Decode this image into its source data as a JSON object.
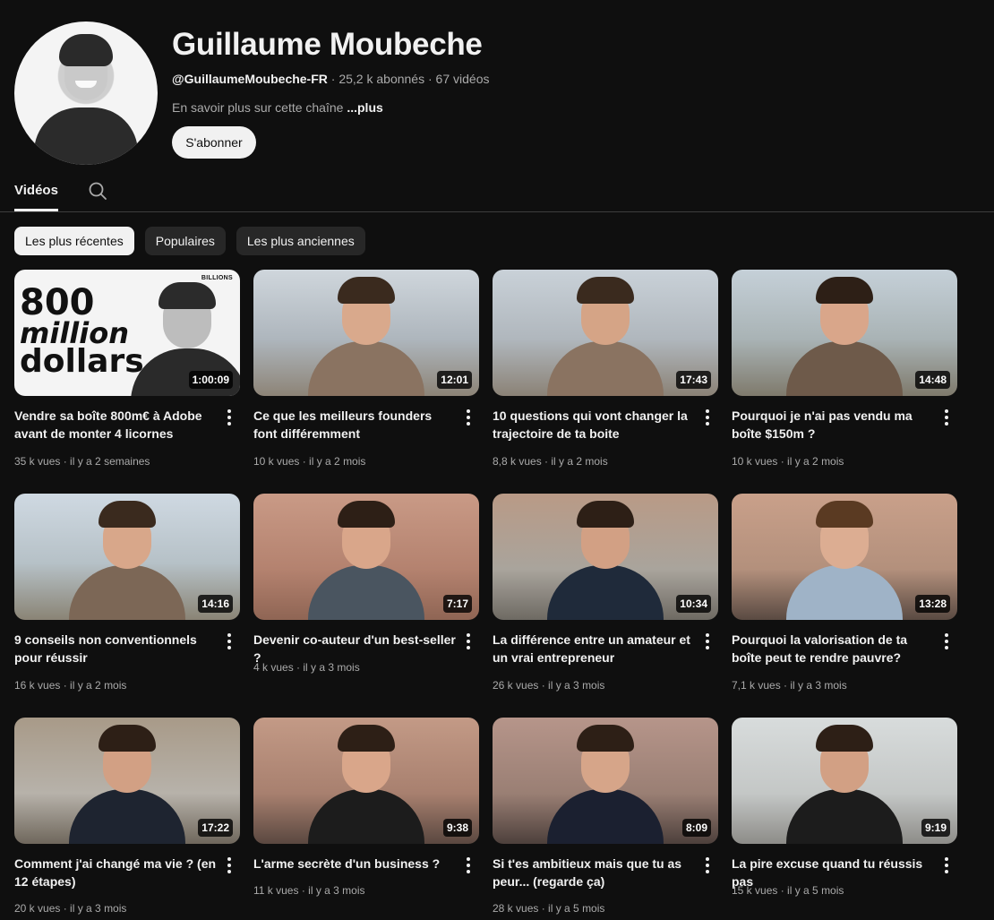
{
  "channel": {
    "name": "Guillaume Moubeche",
    "handle": "@GuillaumeMoubeche-FR",
    "subscribers": "25,2 k abonnés",
    "video_count": "67 vidéos",
    "separator": " · ",
    "about": "En savoir plus sur cette chaîne",
    "about_more": "...plus",
    "subscribe_label": "S'abonner"
  },
  "tabs": {
    "videos_label": "Vidéos"
  },
  "chips": [
    {
      "label": "Les plus récentes",
      "active": true
    },
    {
      "label": "Populaires",
      "active": false
    },
    {
      "label": "Les plus anciennes",
      "active": false
    }
  ],
  "thumb0_text": {
    "line1": "800",
    "line2": "million",
    "line3": "dollars",
    "brand": "BILLIONS"
  },
  "videos": [
    {
      "title": "Vendre sa boîte 800m€ à Adobe avant de monter 4 licornes",
      "views": "35 k vues",
      "age": "il y a 2 semaines",
      "duration": "1:00:09"
    },
    {
      "title": "Ce que les meilleurs founders font différemment",
      "views": "10 k vues",
      "age": "il y a 2 mois",
      "duration": "12:01"
    },
    {
      "title": "10 questions qui vont changer la trajectoire de ta boite",
      "views": "8,8 k vues",
      "age": "il y a 2 mois",
      "duration": "17:43"
    },
    {
      "title": "Pourquoi je n'ai pas vendu ma boîte $150m ?",
      "views": "10 k vues",
      "age": "il y a 2 mois",
      "duration": "14:48"
    },
    {
      "title": "9 conseils non conventionnels pour réussir",
      "views": "16 k vues",
      "age": "il y a 2 mois",
      "duration": "14:16"
    },
    {
      "title": "Devenir co-auteur d'un best-seller ?",
      "views": "4 k vues",
      "age": "il y a 3 mois",
      "duration": "7:17"
    },
    {
      "title": "La différence entre un amateur et un vrai entrepreneur",
      "views": "26 k vues",
      "age": "il y a 3 mois",
      "duration": "10:34"
    },
    {
      "title": "Pourquoi la valorisation de ta boîte peut te rendre pauvre?",
      "views": "7,1 k vues",
      "age": "il y a 3 mois",
      "duration": "13:28"
    },
    {
      "title": "Comment j'ai changé ma vie ? (en 12 étapes)",
      "views": "20 k vues",
      "age": "il y a 3 mois",
      "duration": "17:22"
    },
    {
      "title": "L'arme secrète d'un business ?",
      "views": "11 k vues",
      "age": "il y a 3 mois",
      "duration": "9:38"
    },
    {
      "title": "Si t'es ambitieux mais que tu as peur... (regarde ça)",
      "views": "28 k vues",
      "age": "il y a 5 mois",
      "duration": "8:09"
    },
    {
      "title": "La pire excuse quand tu réussis pas",
      "views": "15 k vues",
      "age": "il y a 5 mois",
      "duration": "9:19"
    }
  ],
  "colors": {
    "background": "#0f0f0f",
    "text_primary": "#f1f1f1",
    "text_secondary": "#aaaaaa",
    "chip_bg": "#272727",
    "chip_active_bg": "#f1f1f1"
  }
}
